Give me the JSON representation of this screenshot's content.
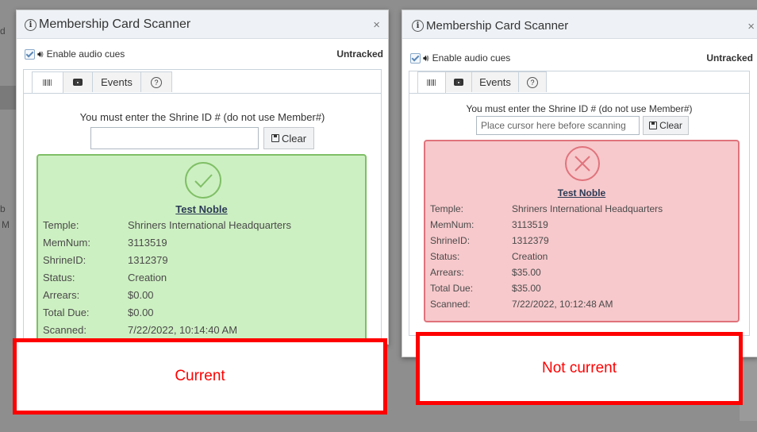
{
  "left": {
    "title": "Membership Card Scanner",
    "close": "×",
    "audio_label": "Enable audio cues",
    "tracking": "Untracked",
    "tabs": [
      "Events"
    ],
    "instruction": "You must enter the Shrine ID # (do not use Member#)",
    "input_value": "",
    "input_placeholder": "",
    "clear_label": "Clear",
    "status_color": "#7fbf66",
    "noble_name": "Test Noble",
    "fields": [
      {
        "label": "Temple:",
        "value": "Shriners International Headquarters"
      },
      {
        "label": "MemNum:",
        "value": "3113519"
      },
      {
        "label": "ShrineID:",
        "value": "1312379"
      },
      {
        "label": "Status:",
        "value": "Creation"
      },
      {
        "label": "Arrears:",
        "value": "$0.00"
      },
      {
        "label": "Total Due:",
        "value": "$0.00"
      },
      {
        "label": "Scanned:",
        "value": "7/22/2022, 10:14:40 AM"
      }
    ],
    "callout": "Current"
  },
  "right": {
    "title": "Membership Card Scanner",
    "close": "×",
    "audio_label": "Enable audio cues",
    "tracking": "Untracked",
    "tabs": [
      "Events"
    ],
    "instruction": "You must enter the Shrine ID # (do not use Member#)",
    "input_value": "",
    "input_placeholder": "Place cursor here before scanning",
    "clear_label": "Clear",
    "status_color": "#e0737c",
    "noble_name": "Test Noble",
    "fields": [
      {
        "label": "Temple:",
        "value": "Shriners International Headquarters"
      },
      {
        "label": "MemNum:",
        "value": "3113519"
      },
      {
        "label": "ShrineID:",
        "value": "1312379"
      },
      {
        "label": "Status:",
        "value": "Creation"
      },
      {
        "label": "Arrears:",
        "value": "$35.00"
      },
      {
        "label": "Total Due:",
        "value": "$35.00"
      },
      {
        "label": "Scanned:",
        "value": "7/22/2022, 10:12:48 AM"
      }
    ],
    "callout": "Not current"
  },
  "background": {
    "fragments": [
      "d",
      "b",
      "M"
    ]
  },
  "icons": {
    "info": "info-icon",
    "close": "close-icon",
    "speaker": "speaker-icon",
    "barcode": "barcode-icon",
    "camera": "camera-icon",
    "help": "help-icon",
    "save": "floppy-icon",
    "check": "check-circle-icon",
    "cross": "x-circle-icon"
  }
}
